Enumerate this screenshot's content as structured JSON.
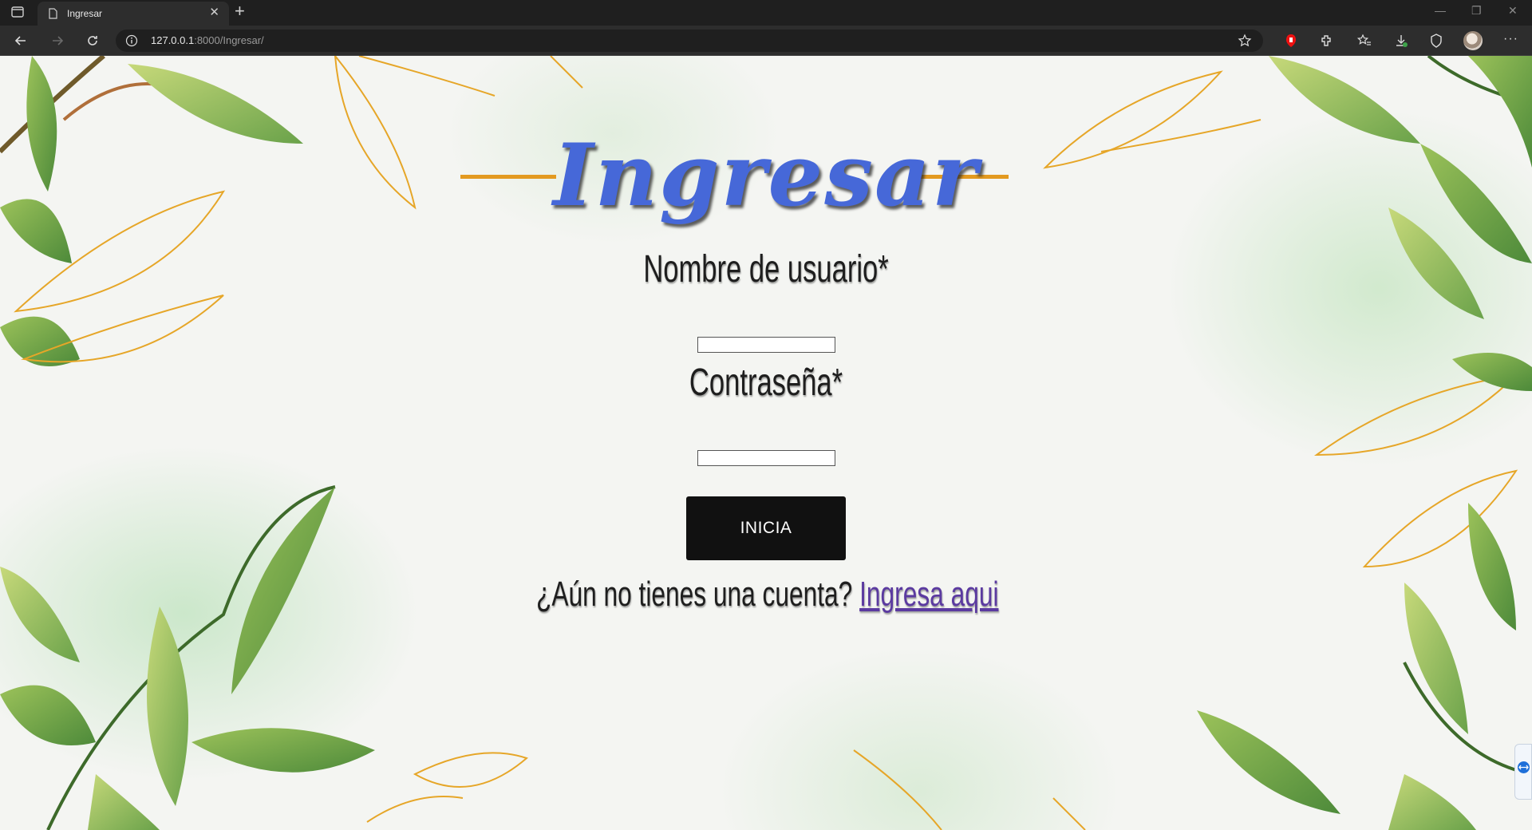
{
  "browser": {
    "tab_title": "Ingresar",
    "url_host": "127.0.0.1",
    "url_rest": ":8000/Ingresar/"
  },
  "page": {
    "title": "Ingresar",
    "username_label": "Nombre de usuario*",
    "username_value": "",
    "password_label": "Contraseña*",
    "password_value": "",
    "submit_label": "INICIA",
    "signup_prompt": "¿Aún no tienes una cuenta?",
    "signup_link": "Ingresa aqui"
  },
  "colors": {
    "title": "#4668d8",
    "title_rule": "#e39a20",
    "button": "#111111",
    "link": "#5b3aa0"
  }
}
